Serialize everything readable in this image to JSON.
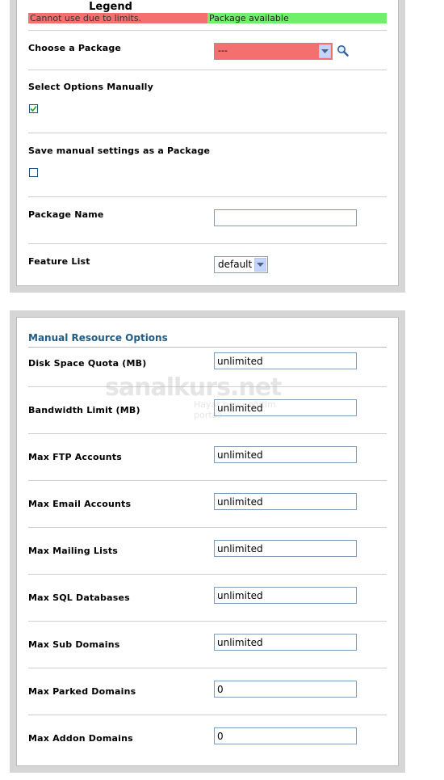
{
  "legend": {
    "title": "Legend",
    "unavailable": "Cannot use due to limits.",
    "available": "Package available",
    "unavailable_color": "#f47070",
    "available_color": "#6ff06a"
  },
  "package": {
    "choose_label": "Choose a Package",
    "selected": "---",
    "search_icon": "magnifier-icon"
  },
  "manual": {
    "select_label": "Select Options Manually",
    "select_checked": true,
    "save_label": "Save manual settings as a Package",
    "save_checked": false
  },
  "package_name": {
    "label": "Package Name",
    "value": ""
  },
  "feature_list": {
    "label": "Feature List",
    "selected": "default"
  },
  "resources": {
    "title": "Manual Resource Options",
    "fields": [
      {
        "label": "Disk Space Quota (MB)",
        "value": "unlimited"
      },
      {
        "label": "Bandwidth Limit (MB)",
        "value": "unlimited"
      },
      {
        "label": "Max FTP Accounts",
        "value": "unlimited"
      },
      {
        "label": "Max Email Accounts",
        "value": "unlimited"
      },
      {
        "label": "Max Mailing Lists",
        "value": "unlimited"
      },
      {
        "label": "Max SQL Databases",
        "value": "unlimited"
      },
      {
        "label": "Max Sub Domains",
        "value": "unlimited"
      },
      {
        "label": "Max Parked Domains",
        "value": "0"
      },
      {
        "label": "Max Addon Domains",
        "value": "0"
      }
    ]
  },
  "watermark": {
    "text": "sanalkurs.net",
    "subtext": "Hayat boyu eğitim portalı"
  }
}
